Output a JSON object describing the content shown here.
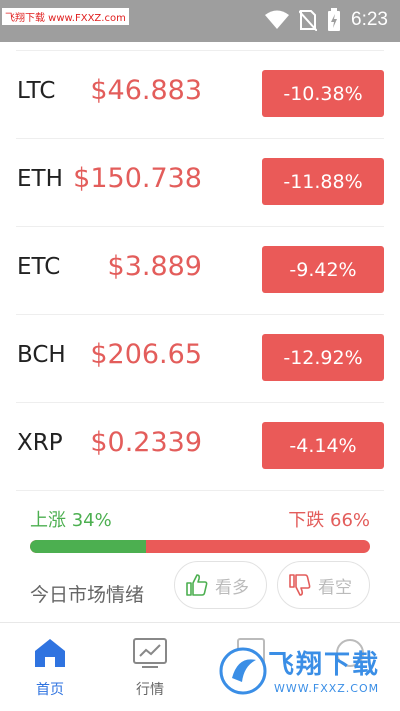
{
  "status_bar": {
    "watermark": "飞翔下载 www.FXXZ.com",
    "time": "6:23"
  },
  "coins": [
    {
      "symbol": "LTC",
      "price": "$46.883",
      "change": "-10.38%"
    },
    {
      "symbol": "ETH",
      "price": "$150.738",
      "change": "-11.88%"
    },
    {
      "symbol": "ETC",
      "price": "$3.889",
      "change": "-9.42%"
    },
    {
      "symbol": "BCH",
      "price": "$206.65",
      "change": "-12.92%"
    },
    {
      "symbol": "XRP",
      "price": "$0.2339",
      "change": "-4.14%"
    }
  ],
  "sentiment": {
    "up_label": "上涨 34%",
    "down_label": "下跌 66%",
    "up_fraction": 0.34,
    "mood_title": "今日市场情绪",
    "bull_button": "看多",
    "bear_button": "看空"
  },
  "nav": {
    "home": "首页",
    "market": "行情"
  },
  "watermark_logo": {
    "title": "飞翔下载",
    "url": "WWW.FXXZ.COM"
  },
  "colors": {
    "down": "#ea5a58",
    "up": "#4caf50",
    "accent": "#2f73e0"
  }
}
